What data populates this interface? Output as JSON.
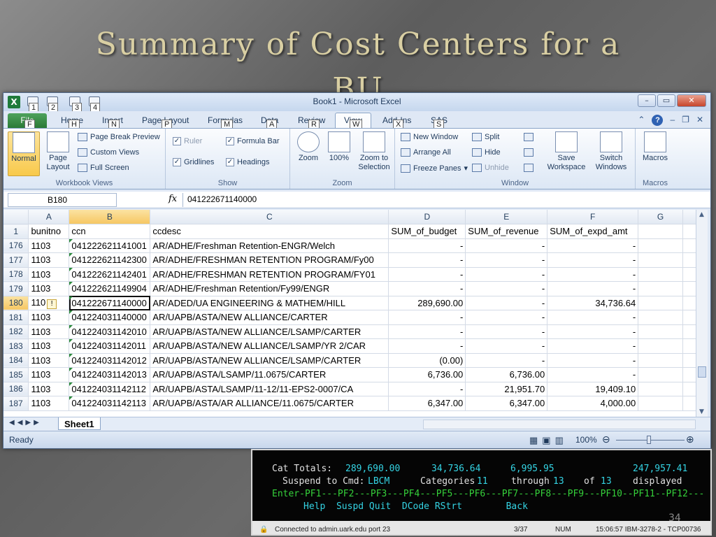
{
  "slide": {
    "title_line1": "Summary of Cost Centers for a",
    "title_line2": "BU",
    "page_number": "34"
  },
  "window": {
    "title": "Book1 - Microsoft Excel",
    "qat_keytips": [
      "1",
      "2",
      "3",
      "4"
    ],
    "buttons": {
      "minimize": "–",
      "restore": "▭",
      "close": "✕"
    }
  },
  "ribbon_tabs": [
    {
      "label": "File",
      "keytip": "F"
    },
    {
      "label": "Home",
      "keytip": "H"
    },
    {
      "label": "Insert",
      "keytip": "N"
    },
    {
      "label": "Page Layout",
      "keytip": "P"
    },
    {
      "label": "Formulas",
      "keytip": "M"
    },
    {
      "label": "Data",
      "keytip": "A"
    },
    {
      "label": "Review",
      "keytip": "R"
    },
    {
      "label": "View",
      "keytip": "W"
    },
    {
      "label": "Add-Ins",
      "keytip": "X"
    },
    {
      "label": "SAS",
      "keytip": "S"
    }
  ],
  "ribbon": {
    "workbook_views": {
      "label": "Workbook Views",
      "normal": "Normal",
      "page_layout": "Page Layout",
      "page_break_preview": "Page Break Preview",
      "custom_views": "Custom Views",
      "full_screen": "Full Screen"
    },
    "show": {
      "label": "Show",
      "ruler": "Ruler",
      "formula_bar": "Formula Bar",
      "gridlines": "Gridlines",
      "headings": "Headings"
    },
    "zoom": {
      "label": "Zoom",
      "zoom": "Zoom",
      "hundred": "100%",
      "zoom_to_selection": "Zoom to Selection"
    },
    "window": {
      "label": "Window",
      "new_window": "New Window",
      "arrange_all": "Arrange All",
      "freeze_panes": "Freeze Panes",
      "split": "Split",
      "hide": "Hide",
      "unhide": "Unhide",
      "save_workspace": "Save Workspace",
      "switch_windows": "Switch Windows"
    },
    "macros": {
      "label": "Macros",
      "macros": "Macros"
    }
  },
  "formula_bar": {
    "name_box": "B180",
    "fx": "fx",
    "value": "041222671140000"
  },
  "grid": {
    "column_letters": [
      "A",
      "B",
      "C",
      "D",
      "E",
      "F",
      "G"
    ],
    "header_row": {
      "row_num": "1",
      "cells": [
        "bunitno",
        "ccn",
        "ccdesc",
        "SUM_of_budget",
        "SUM_of_revenue",
        "SUM_of_expd_amt",
        ""
      ]
    },
    "rows": [
      {
        "n": "176",
        "a": "1103",
        "b": "041222621141001",
        "c": "AR/ADHE/Freshman Retention-ENGR/Welch",
        "d": "-",
        "e": "-",
        "f": "-"
      },
      {
        "n": "177",
        "a": "1103",
        "b": "041222621142300",
        "c": "AR/ADHE/FRESHMAN RETENTION PROGRAM/Fy00",
        "d": "-",
        "e": "-",
        "f": "-"
      },
      {
        "n": "178",
        "a": "1103",
        "b": "041222621142401",
        "c": "AR/ADHE/FRESHMAN RETENTION PROGRAM/FY01",
        "d": "-",
        "e": "-",
        "f": "-"
      },
      {
        "n": "179",
        "a": "1103",
        "b": "041222621149904",
        "c": "AR/ADHE/Freshman Retention/Fy99/ENGR",
        "d": "-",
        "e": "-",
        "f": "-"
      },
      {
        "n": "180",
        "a": "110",
        "b": "041222671140000",
        "c": "AR/ADED/UA ENGINEERING & MATHEM/HILL",
        "d": "289,690.00",
        "e": "-",
        "f": "34,736.64"
      },
      {
        "n": "181",
        "a": "1103",
        "b": "041224031140000",
        "c": "AR/UAPB/ASTA/NEW ALLIANCE/CARTER",
        "d": "-",
        "e": "-",
        "f": "-"
      },
      {
        "n": "182",
        "a": "1103",
        "b": "041224031142010",
        "c": "AR/UAPB/ASTA/NEW ALLIANCE/LSAMP/CARTER",
        "d": "-",
        "e": "-",
        "f": "-"
      },
      {
        "n": "183",
        "a": "1103",
        "b": "041224031142011",
        "c": "AR/UAPB/ASTA/NEW ALLIANCE/LSAMP/YR 2/CAR",
        "d": "-",
        "e": "-",
        "f": "-"
      },
      {
        "n": "184",
        "a": "1103",
        "b": "041224031142012",
        "c": "AR/UAPB/ASTA/NEW ALLIANCE/LSAMP/CARTER",
        "d": "(0.00)",
        "e": "-",
        "f": "-"
      },
      {
        "n": "185",
        "a": "1103",
        "b": "041224031142013",
        "c": "AR/UAPB/ASTA/LSAMP/11.0675/CARTER",
        "d": "6,736.00",
        "e": "6,736.00",
        "f": "-"
      },
      {
        "n": "186",
        "a": "1103",
        "b": "041224031142112",
        "c": "AR/UAPB/ASTA/LSAMP/11-12/11-EPS2-0007/CA",
        "d": "-",
        "e": "21,951.70",
        "f": "19,409.10"
      },
      {
        "n": "187",
        "a": "1103",
        "b": "041224031142113",
        "c": "AR/UAPB/ASTA/AR ALLIANCE/11.0675/CARTER",
        "d": "6,347.00",
        "e": "6,347.00",
        "f": "4,000.00"
      }
    ]
  },
  "sheet_tab": "Sheet1",
  "status": {
    "ready": "Ready",
    "zoom": "100%"
  },
  "terminal": {
    "totals_label": "Cat Totals:",
    "totals": [
      "289,690.00",
      "34,736.64",
      "6,995.95",
      "247,957.41"
    ],
    "suspend_label": "Suspend to Cmd:",
    "suspend_value": "LBCM",
    "categories_label": "Categories",
    "categories_from": "11",
    "through_label": "through",
    "categories_to": "13",
    "of_label": "of",
    "categories_total": "13",
    "displayed_label": "displayed",
    "pf_line": "Enter-PF1---PF2---PF3---PF4---PF5---PF6---PF7---PF8---PF9---PF10--PF11--PF12---",
    "keys_line": "Help  Suspd Quit  DCode RStrt        Back",
    "status_connection": "Connected to admin.uark.edu port 23",
    "status_page": "3/37",
    "status_num": "NUM",
    "status_time": "15:06:57 IBM-3278-2 - TCP00736"
  },
  "colors": {
    "title_gold": "#d9cfa3",
    "excel_green": "#2a7a36",
    "terminal_cyan": "#34d3e3",
    "terminal_green": "#35d03a"
  }
}
